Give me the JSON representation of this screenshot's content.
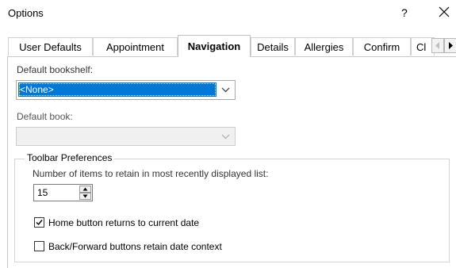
{
  "window": {
    "title": "Options",
    "help_label": "?",
    "close_icon": "close-icon"
  },
  "tabs": [
    {
      "label": "User Defaults",
      "active": false
    },
    {
      "label": "Appointment",
      "active": false
    },
    {
      "label": "Navigation",
      "active": true
    },
    {
      "label": "Details",
      "active": false
    },
    {
      "label": "Allergies",
      "active": false
    },
    {
      "label": "Confirm",
      "active": false
    },
    {
      "label": "Cl",
      "active": false
    }
  ],
  "navigation": {
    "default_bookshelf_label": "Default bookshelf:",
    "default_bookshelf_value": "<None>",
    "default_book_label": "Default book:",
    "default_book_value": "",
    "toolbar_group_title": "Toolbar Preferences",
    "retain_items_label": "Number of items to retain in most recently displayed list:",
    "retain_items_value": "15",
    "home_button_label": "Home button returns to current date",
    "home_button_checked": true,
    "back_forward_label": "Back/Forward buttons retain date context",
    "back_forward_checked": false
  },
  "colors": {
    "selection": "#0078d7",
    "border": "#a9a9a9"
  }
}
